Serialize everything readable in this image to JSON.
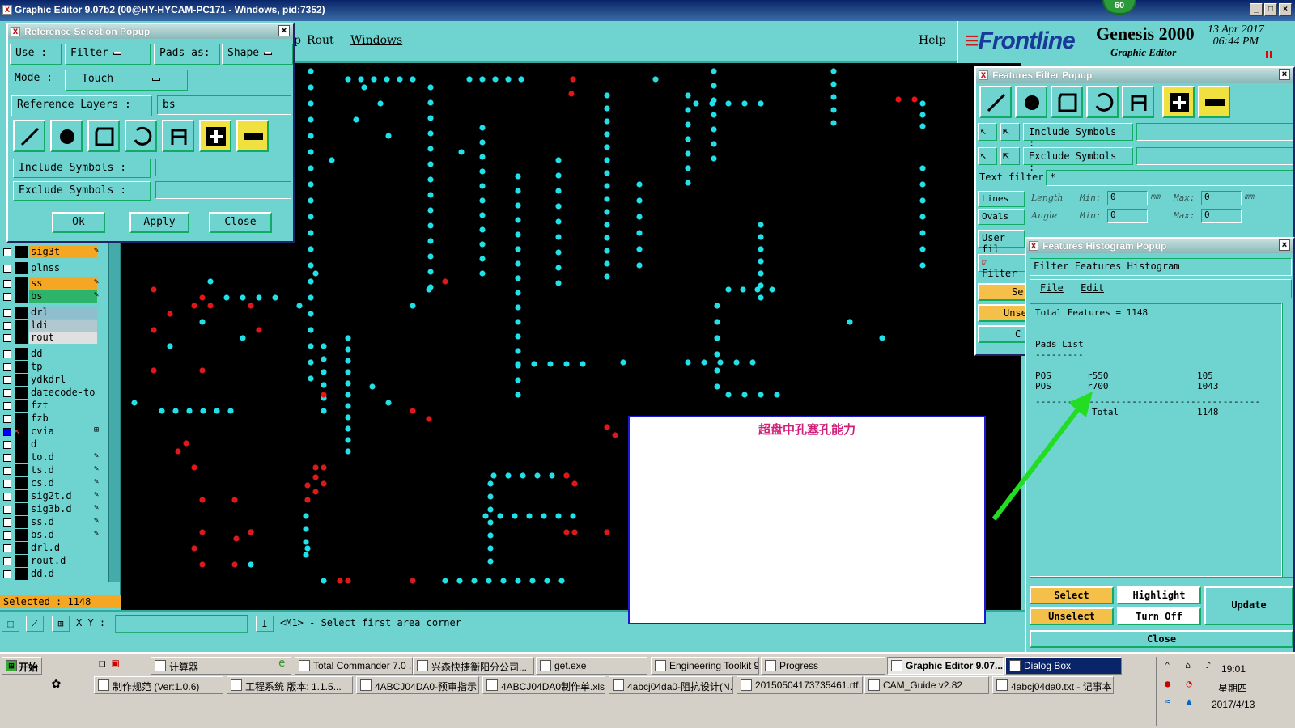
{
  "window": {
    "title": "Graphic Editor 9.07b2 (00@HY-HYCAM-PC171 - Windows, pid:7352)",
    "badge": "60"
  },
  "menu": {
    "items": [
      "p",
      "Rout",
      "Windows"
    ],
    "help": "Help"
  },
  "brand": {
    "logo": "Frontline",
    "product": "Genesis 2000",
    "subtitle": "Graphic Editor",
    "date": "13 Apr 2017",
    "time": "06:44 PM"
  },
  "layers": [
    {
      "name": "sig3t",
      "color": "#f5a623",
      "mark": "✎"
    },
    {
      "name": "plnss",
      "color": "#6fd3d0",
      "mark": ""
    },
    {
      "name": "ss",
      "color": "#f5a623",
      "mark": "✎"
    },
    {
      "name": "bs",
      "color": "#2db36a",
      "mark": "✎"
    },
    {
      "name": "drl",
      "color": "#8fbfcf",
      "mark": ""
    },
    {
      "name": "ldi",
      "color": "#b0c8d0",
      "mark": ""
    },
    {
      "name": "rout",
      "color": "#e0e0e0",
      "mark": ""
    },
    {
      "name": "dd",
      "color": "#6fd3d0",
      "mark": ""
    },
    {
      "name": "tp",
      "color": "#6fd3d0",
      "mark": ""
    },
    {
      "name": "ydkdrl",
      "color": "#6fd3d0",
      "mark": ""
    },
    {
      "name": "datecode-to",
      "color": "#6fd3d0",
      "mark": ""
    },
    {
      "name": "fzt",
      "color": "#6fd3d0",
      "mark": ""
    },
    {
      "name": "fzb",
      "color": "#6fd3d0",
      "mark": ""
    },
    {
      "name": "cvia",
      "color": "#6fd3d0",
      "mark": "⊞"
    },
    {
      "name": "d",
      "color": "#6fd3d0",
      "mark": ""
    },
    {
      "name": "to.d",
      "color": "#6fd3d0",
      "mark": "✎"
    },
    {
      "name": "ts.d",
      "color": "#6fd3d0",
      "mark": "✎"
    },
    {
      "name": "cs.d",
      "color": "#6fd3d0",
      "mark": "✎"
    },
    {
      "name": "sig2t.d",
      "color": "#6fd3d0",
      "mark": "✎"
    },
    {
      "name": "sig3b.d",
      "color": "#6fd3d0",
      "mark": "✎"
    },
    {
      "name": "ss.d",
      "color": "#6fd3d0",
      "mark": "✎"
    },
    {
      "name": "bs.d",
      "color": "#6fd3d0",
      "mark": "✎"
    },
    {
      "name": "drl.d",
      "color": "#6fd3d0",
      "mark": ""
    },
    {
      "name": "rout.d",
      "color": "#6fd3d0",
      "mark": ""
    },
    {
      "name": "dd.d",
      "color": "#6fd3d0",
      "mark": ""
    }
  ],
  "selected_label": "Selected : 1148",
  "status": {
    "xy_label": "X Y :",
    "prompt": "<M1> - Select first area corner"
  },
  "ref_popup": {
    "title": "Reference Selection Popup",
    "use_label": "Use  :",
    "use_value": "Filter",
    "pads_label": "Pads as:",
    "pads_value": "Shape",
    "mode_label": "Mode  :",
    "mode_value": "Touch",
    "ref_layers_label": "Reference Layers :",
    "ref_layers_value": "bs",
    "include_label": "Include Symbols :",
    "exclude_label": "Exclude Symbols :",
    "ok": "Ok",
    "apply": "Apply",
    "close": "Close"
  },
  "filter_popup": {
    "title": "Features Filter Popup",
    "include_label": "Include Symbols :",
    "exclude_label": "Exclude Symbols :",
    "text_filter_label": "Text filter",
    "text_filter_value": "*",
    "lines": "Lines",
    "ovals": "Ovals",
    "length": "Length",
    "angle": "Angle",
    "min": "Min:",
    "max": "Max:",
    "min_val": "0",
    "max_val": "0",
    "unit": "mm",
    "user_fil": "User fil",
    "filter": "Filter",
    "sel": "Se",
    "unsel": "Unse",
    "c": "C"
  },
  "hist_popup": {
    "title": "Features Histogram Popup",
    "header": "Filter Features Histogram",
    "menu_file": "File",
    "menu_edit": "Edit",
    "total": "Total Features = 1148",
    "pads_list": "Pads List",
    "underline": "---------",
    "rows": [
      {
        "pol": "POS",
        "sym": "r550",
        "count": "105"
      },
      {
        "pol": "POS",
        "sym": "r700",
        "count": "1043"
      }
    ],
    "divider": "------------------------------------------",
    "total_label": "Total",
    "total_value": "1148",
    "select": "Select",
    "highlight": "Highlight",
    "update": "Update",
    "unselect": "Unselect",
    "turnoff": "Turn Off",
    "close": "Close"
  },
  "annotation": "超盘中孔塞孔能力",
  "taskbar": {
    "start": "开始",
    "row1": [
      {
        "label": "计算器",
        "icon": "calculator-icon"
      },
      {
        "label": "Total Commander 7.0 ...",
        "icon": "disk-icon"
      },
      {
        "label": "兴森快捷衡阳分公司...",
        "icon": "star-icon"
      },
      {
        "label": "get.exe",
        "icon": "app-icon"
      },
      {
        "label": "Engineering Toolkit 9....",
        "icon": "x-icon"
      },
      {
        "label": "Progress",
        "icon": "x-icon"
      },
      {
        "label": "Graphic Editor 9.07...",
        "icon": "x-icon"
      },
      {
        "label": "Dialog Box",
        "icon": "x-icon"
      }
    ],
    "row2": [
      {
        "label": "制作规范 (Ver:1.0.6)",
        "icon": "doc-icon"
      },
      {
        "label": "工程系统  版本: 1.1.5...",
        "icon": "app-icon"
      },
      {
        "label": "4ABCJ04DA0-预审指示...",
        "icon": "word-icon"
      },
      {
        "label": "4ABCJ04DA0制作单.xls ...",
        "icon": "excel-icon"
      },
      {
        "label": "4abcj04da0-阻抗设计(N...",
        "icon": "word-icon"
      },
      {
        "label": "20150504173735461.rtf...",
        "icon": "word-icon"
      },
      {
        "label": "CAM_Guide v2.82",
        "icon": "app-icon"
      },
      {
        "label": "4abcj04da0.txt - 记事本",
        "icon": "notepad-icon"
      }
    ],
    "clock": "19:01",
    "weekday": "星期四",
    "date": "2017/4/13"
  }
}
